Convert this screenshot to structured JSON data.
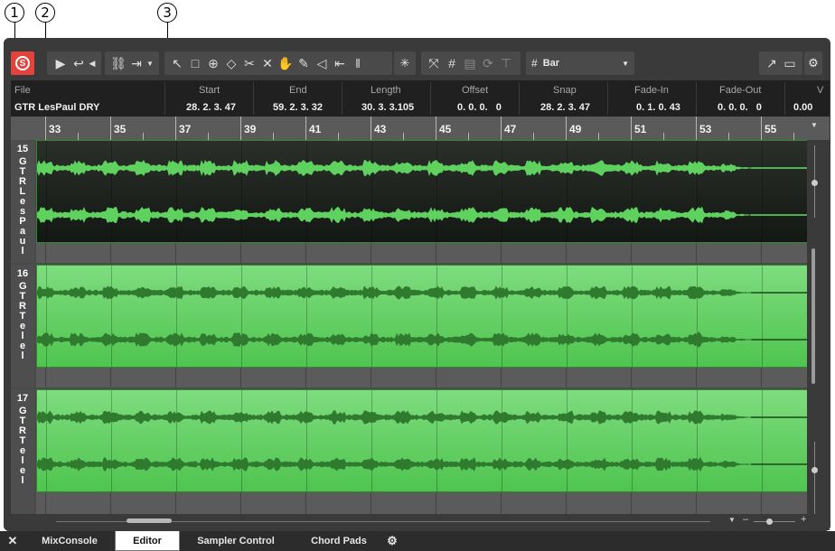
{
  "callouts": [
    "1",
    "2",
    "3"
  ],
  "toolbar": {
    "solo_label": "S",
    "snap_type": "Bar"
  },
  "infoline": {
    "fields": [
      {
        "label": "File",
        "value": "GTR LesPaul DRY"
      },
      {
        "label": "Start",
        "value": "28. 2. 3. 47"
      },
      {
        "label": "End",
        "value": "59. 2. 3. 32"
      },
      {
        "label": "Length",
        "value": "30. 3. 3.105"
      },
      {
        "label": "Offset",
        "value": "0. 0. 0.   0"
      },
      {
        "label": "Snap",
        "value": "28. 2. 3. 47"
      },
      {
        "label": "Fade-In",
        "value": "0. 1. 0. 43"
      },
      {
        "label": "Fade-Out",
        "value": "0. 0. 0.   0"
      },
      {
        "label": "V",
        "value": "0.00"
      }
    ]
  },
  "ruler": {
    "bars": [
      "33",
      "35",
      "37",
      "39",
      "41",
      "43",
      "45",
      "47",
      "49",
      "51",
      "53",
      "55"
    ]
  },
  "tracks": [
    {
      "number": "15",
      "name": "GTR LesPaul",
      "selected": true,
      "color": "#1f2a1f",
      "wave": "#5ed15e"
    },
    {
      "number": "16",
      "name": "GTR Tele l",
      "selected": false,
      "color": "#5fd05f",
      "wave": "#2f7a2f"
    },
    {
      "number": "17",
      "name": "GTR Tele l",
      "selected": false,
      "color": "#5fd05f",
      "wave": "#2f7a2f"
    }
  ],
  "bottom_tabs": [
    {
      "label": "MixConsole",
      "active": false
    },
    {
      "label": "Editor",
      "active": true
    },
    {
      "label": "Sampler Control",
      "active": false
    },
    {
      "label": "Chord Pads",
      "active": false
    }
  ],
  "icons": [
    "solo-icon",
    "play-icon",
    "loop-icon",
    "link-icon",
    "object-select-icon",
    "range-select-icon",
    "zoom-icon",
    "erase-icon",
    "split-icon",
    "mute-icon",
    "hand-icon",
    "draw-icon",
    "audition-icon",
    "timewarp-icon",
    "snap-icon",
    "grid-icon",
    "open-window-icon",
    "settings-icon",
    "close-icon",
    "gear-icon"
  ]
}
